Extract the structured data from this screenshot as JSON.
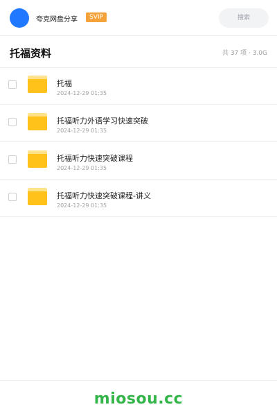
{
  "topbar": {
    "brand": "夸克网盘分享",
    "badge": "SVIP",
    "search_label": "搜索"
  },
  "header": {
    "title": "托福资料",
    "meta": "共 37 项 · 3.0G"
  },
  "files": [
    {
      "name": "托福",
      "date": "2024-12-29 01:35"
    },
    {
      "name": "托福听力外语学习快速突破",
      "date": "2024-12-29 01:35"
    },
    {
      "name": "托福听力快速突破课程",
      "date": "2024-12-29 01:35"
    },
    {
      "name": "托福听力快速突破课程-讲义",
      "date": "2024-12-29 01:35"
    }
  ],
  "footer": {
    "logo_text": "miosou.cc"
  },
  "colors": {
    "avatar": "#1f78ff",
    "badge": "#f4a23a",
    "folder": "#ffc21a",
    "logo": "#33b54a"
  },
  "icons": [
    "avatar",
    "checkbox",
    "folder-icon"
  ]
}
